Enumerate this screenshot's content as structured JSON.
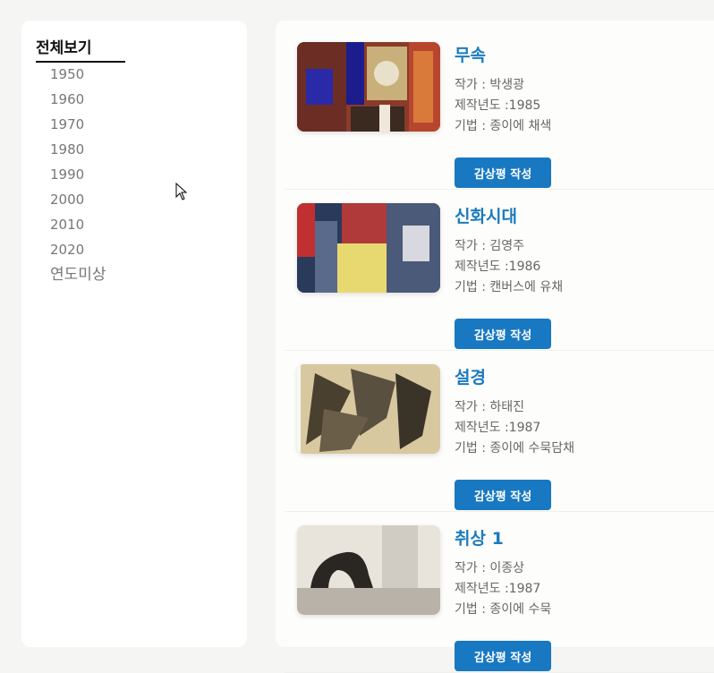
{
  "sidebar": {
    "title": "전체보기",
    "items": [
      "1950",
      "1960",
      "1970",
      "1980",
      "1990",
      "2000",
      "2010",
      "2020",
      "연도미상"
    ]
  },
  "artworks": [
    {
      "title": "무속",
      "artist": "작가 : 박생광",
      "year": "제작년도 :1985",
      "technique": "기법 : 종이에 채색",
      "button": "감상평 작성"
    },
    {
      "title": "신화시대",
      "artist": "작가 : 김영주",
      "year": "제작년도 :1986",
      "technique": "기법 : 캔버스에 유채",
      "button": "감상평 작성"
    },
    {
      "title": "설경",
      "artist": "작가 : 하태진",
      "year": "제작년도 :1987",
      "technique": "기법 : 종이에 수묵담채",
      "button": "감상평 작성"
    },
    {
      "title": "취상 1",
      "artist": "작가 : 이종상",
      "year": "제작년도 :1987",
      "technique": "기법 : 종이에 수묵",
      "button": "감상평 작성"
    }
  ],
  "colors": {
    "accent": "#1878c2",
    "title": "#1a7bbf"
  }
}
